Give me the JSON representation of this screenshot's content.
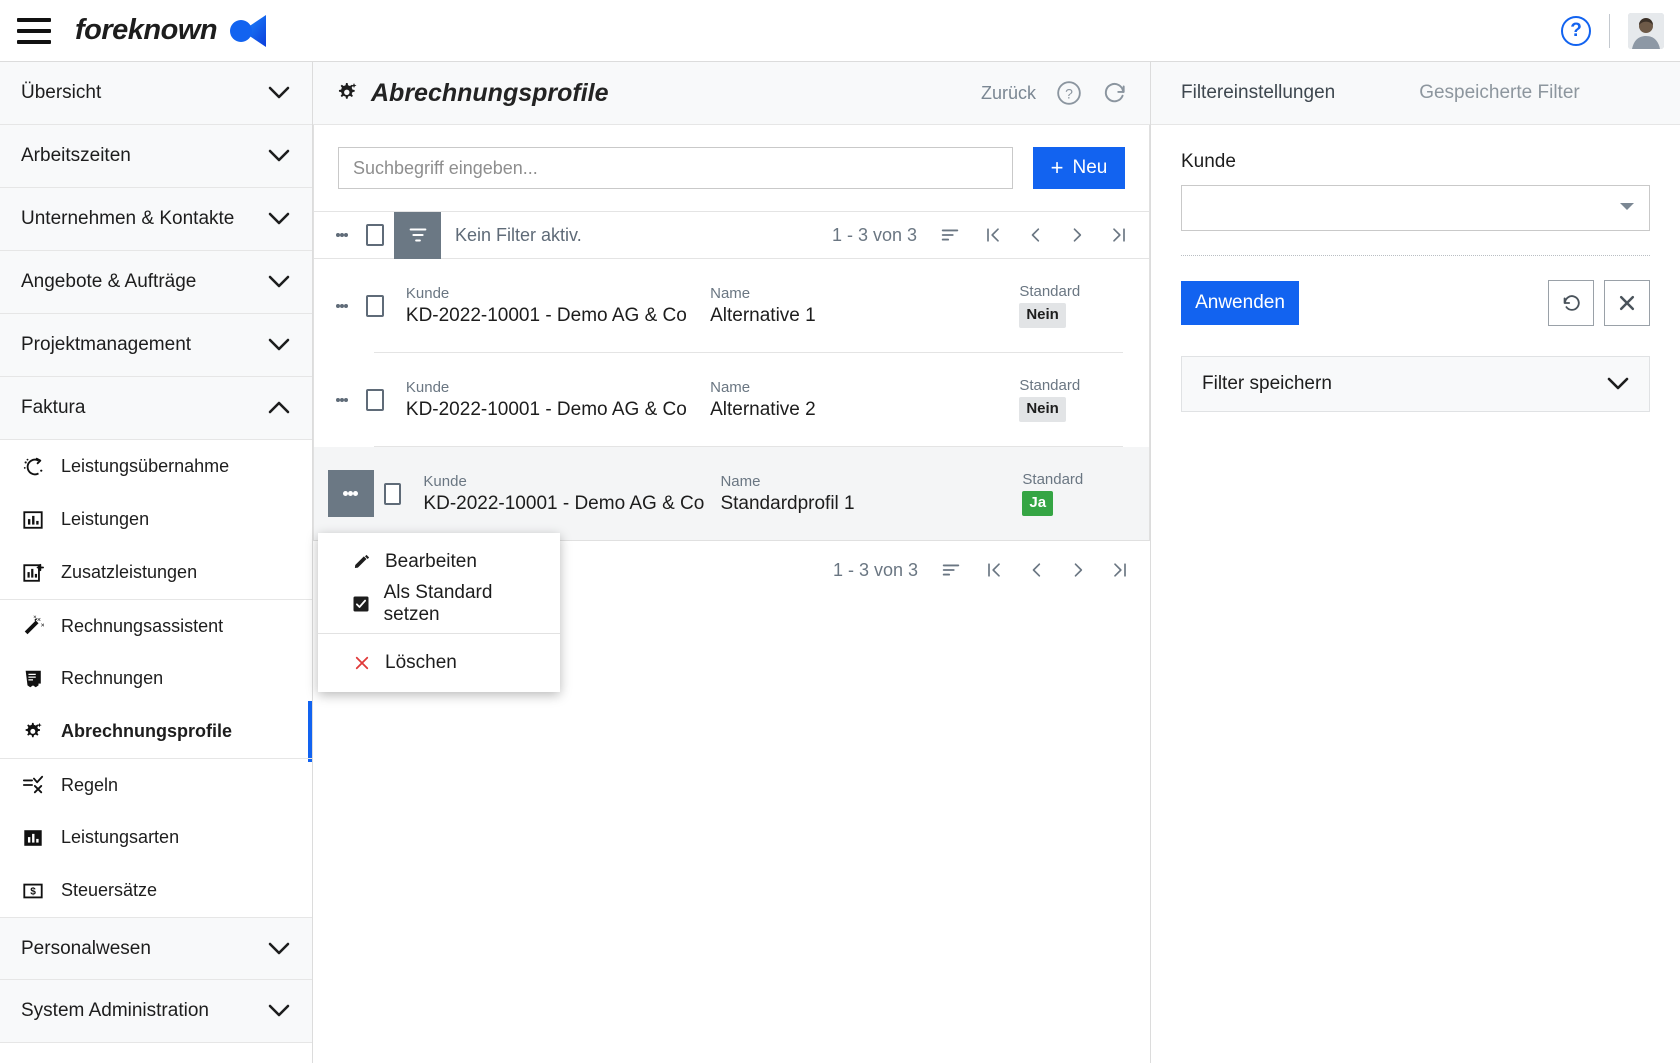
{
  "topbar": {
    "brand": "foreknown",
    "menu_icon": "hamburger-icon",
    "help_icon": "?",
    "avatar_alt": "user-avatar"
  },
  "sidebar": {
    "groups": [
      {
        "label": "Übersicht",
        "expanded": false
      },
      {
        "label": "Arbeitszeiten",
        "expanded": false
      },
      {
        "label": "Unternehmen & Kontakte",
        "expanded": false
      },
      {
        "label": "Angebote & Aufträge",
        "expanded": false
      },
      {
        "label": "Projektmanagement",
        "expanded": false
      },
      {
        "label": "Faktura",
        "expanded": true
      }
    ],
    "faktura_items": [
      {
        "label": "Leistungsübernahme",
        "icon": "magic-transfer-icon",
        "active": false,
        "separator": false
      },
      {
        "label": "Leistungen",
        "icon": "bar-chart-outline-icon",
        "active": false,
        "separator": false
      },
      {
        "label": "Zusatzleistungen",
        "icon": "bar-chart-plus-icon",
        "active": false,
        "separator": false
      },
      {
        "label": "Rechnungsassistent",
        "icon": "magic-wand-icon",
        "active": false,
        "separator": true
      },
      {
        "label": "Rechnungen",
        "icon": "invoice-icon",
        "active": false,
        "separator": false
      },
      {
        "label": "Abrechnungsprofile",
        "icon": "gear-sparkle-icon",
        "active": true,
        "separator": false
      },
      {
        "label": "Regeln",
        "icon": "rules-icon",
        "active": false,
        "separator": true
      },
      {
        "label": "Leistungsarten",
        "icon": "bar-chart-filled-icon",
        "active": false,
        "separator": false
      },
      {
        "label": "Steuersätze",
        "icon": "tax-money-icon",
        "active": false,
        "separator": false
      }
    ],
    "groups_bottom": [
      {
        "label": "Personalwesen",
        "expanded": false
      },
      {
        "label": "System Administration",
        "expanded": false
      }
    ]
  },
  "main": {
    "title": "Abrechnungsprofile",
    "title_icon": "gear-sparkle-icon",
    "back_label": "Zurück",
    "help_icon": "help-circle-icon",
    "refresh_icon": "refresh-icon",
    "search_placeholder": "Suchbegriff eingeben...",
    "search_value": "",
    "new_button": "Neu",
    "toolbar": {
      "filter_status": "Kein Filter aktiv.",
      "filter_icon": "filter-icon",
      "kebab_icon": "more-vertical-icon",
      "select_all_icon": "checkbox-icon"
    },
    "pager": {
      "count": "1 - 3 von 3",
      "sort_icon": "sort-icon",
      "first_icon": "first-page-icon",
      "prev_icon": "prev-page-icon",
      "next_icon": "next-page-icon",
      "last_icon": "last-page-icon"
    },
    "columns": {
      "kunde": "Kunde",
      "name": "Name",
      "standard": "Standard"
    },
    "rows": [
      {
        "kunde": "KD-2022-10001 - Demo AG & Co",
        "name": "Alternative 1",
        "standard": "Nein",
        "standard_state": "no",
        "selected": false
      },
      {
        "kunde": "KD-2022-10001 - Demo AG & Co",
        "name": "Alternative 2",
        "standard": "Nein",
        "standard_state": "no",
        "selected": false
      },
      {
        "kunde": "KD-2022-10001 - Demo AG & Co",
        "name": "Standardprofil 1",
        "standard": "Ja",
        "standard_state": "yes",
        "selected": true
      }
    ]
  },
  "context_menu": {
    "items": [
      {
        "label": "Bearbeiten",
        "icon": "pencil-icon"
      },
      {
        "label": "Als Standard setzen",
        "icon": "checkbox-checked-icon"
      },
      {
        "label": "Löschen",
        "icon": "close-x-icon"
      }
    ]
  },
  "filter_panel": {
    "tab_settings": "Filtereinstellungen",
    "tab_saved": "Gespeicherte Filter",
    "kunde_label": "Kunde",
    "kunde_value": "",
    "apply_button": "Anwenden",
    "reset_icon": "undo-icon",
    "clear_icon": "close-x-icon",
    "save_filter_label": "Filter speichern",
    "chevron_icon": "chevron-down-icon"
  },
  "colors": {
    "accent": "#1263f0",
    "badge_yes_bg": "#35a544",
    "badge_no_bg": "#e2e4e6",
    "toolbar_dark": "#6b7884"
  }
}
